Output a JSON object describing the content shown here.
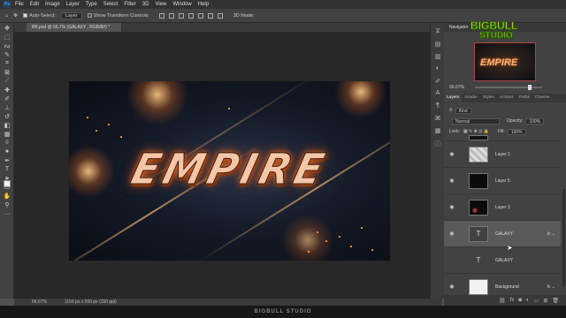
{
  "menu": [
    "File",
    "Edit",
    "Image",
    "Layer",
    "Type",
    "Select",
    "Filter",
    "3D",
    "View",
    "Window",
    "Help"
  ],
  "app_logo": "Ps",
  "options": {
    "auto_select_label": "Auto-Select:",
    "auto_select_value": "Layer",
    "show_transform_label": "Show Transform Controls"
  },
  "document": {
    "tab_title": "BB.psd @ 66.7% (GALAXY , RGB/8#) *",
    "artwork_text": "EMPIRE"
  },
  "status": {
    "zoom": "66.67%",
    "doc_info": "1156 px x 650 px (150 ppi)"
  },
  "navigator": {
    "title": "Navigator",
    "zoom": "66.67%",
    "thumb_text": "EMPIRE"
  },
  "watermark": {
    "line1": "BIGBULL",
    "line2": "STUDIO",
    "footer": "BIGBULL STUDIO"
  },
  "layers_panel": {
    "tabs": [
      "Layers",
      "Gradie",
      "Styles",
      "Actions",
      "Paths",
      "Channe"
    ],
    "kind_label": "Kind",
    "blend_mode": "Normal",
    "opacity_label": "Opacity:",
    "opacity_value": "100%",
    "lock_label": "Lock:",
    "fill_label": "Fill:",
    "fill_value": "100%",
    "layers": [
      {
        "name": "Layer 1",
        "fx": false,
        "selected": false
      },
      {
        "name": "Layer 5",
        "fx": false,
        "selected": false
      },
      {
        "name": "Layer 3",
        "fx": false,
        "selected": false
      },
      {
        "name": "GALAXY",
        "fx": true,
        "selected": true
      },
      {
        "name": "GALAXY",
        "fx": false,
        "selected": false
      },
      {
        "name": "Background",
        "fx": true,
        "selected": false
      }
    ],
    "footer_icons": [
      "link-icon",
      "fx-icon",
      "mask-icon",
      "adjustment-icon",
      "folder-icon",
      "new-layer-icon",
      "trash-icon"
    ]
  },
  "colors": {
    "accent": "#31a8ff",
    "text_glow": "#ff7828"
  }
}
